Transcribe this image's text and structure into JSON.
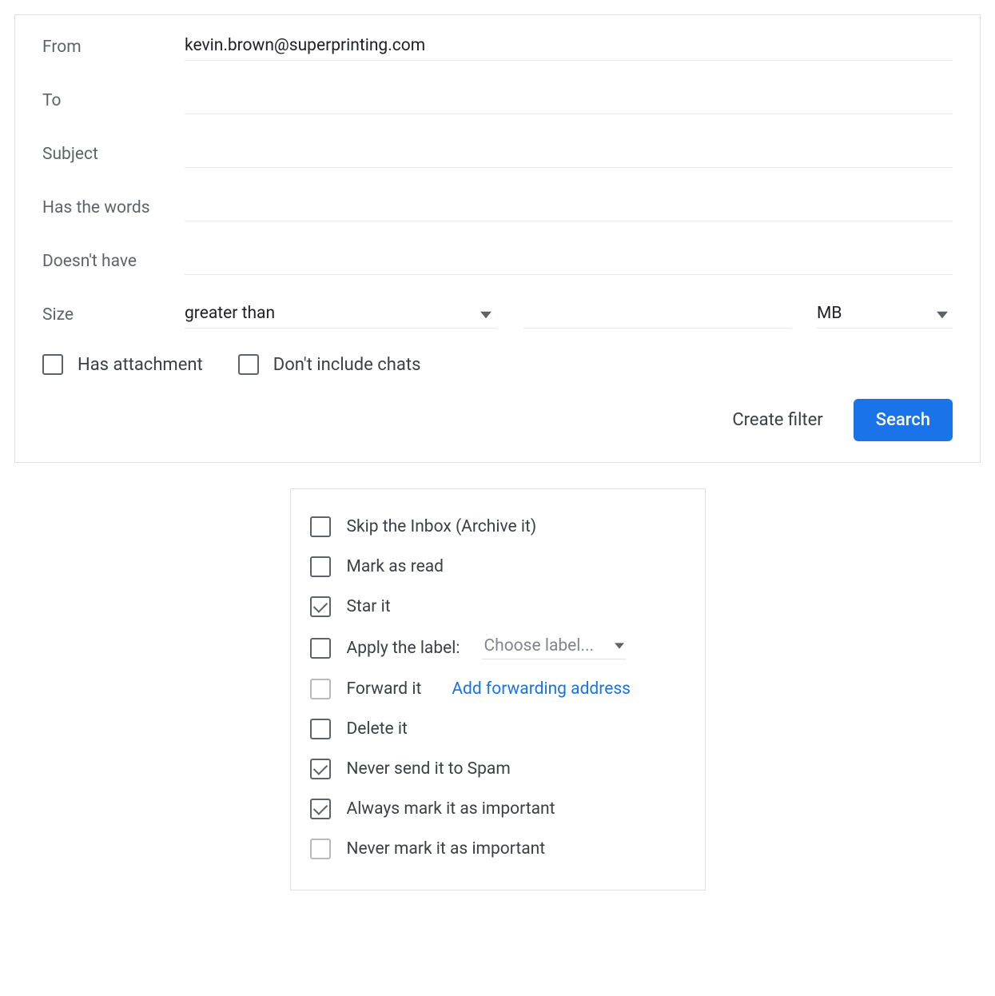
{
  "form": {
    "from": {
      "label": "From",
      "value": "kevin.brown@superprinting.com"
    },
    "to": {
      "label": "To",
      "value": ""
    },
    "subject": {
      "label": "Subject",
      "value": ""
    },
    "has_words": {
      "label": "Has the words",
      "value": ""
    },
    "doesnt_have": {
      "label": "Doesn't have",
      "value": ""
    },
    "size": {
      "label": "Size",
      "operator": "greater than",
      "value": "",
      "unit": "MB"
    },
    "has_attachment": {
      "label": "Has attachment",
      "checked": false
    },
    "no_chats": {
      "label": "Don't include chats",
      "checked": false
    },
    "create_filter": "Create filter",
    "search": "Search"
  },
  "options": {
    "skip_inbox": {
      "label": "Skip the Inbox (Archive it)",
      "checked": false
    },
    "mark_read": {
      "label": "Mark as read",
      "checked": false
    },
    "star_it": {
      "label": "Star it",
      "checked": true
    },
    "apply_label": {
      "label": "Apply the label:",
      "checked": false,
      "select_text": "Choose label..."
    },
    "forward_it": {
      "label": "Forward it",
      "checked": false,
      "link": "Add forwarding address"
    },
    "delete_it": {
      "label": "Delete it",
      "checked": false
    },
    "never_spam": {
      "label": "Never send it to Spam",
      "checked": true
    },
    "always_imp": {
      "label": "Always mark it as important",
      "checked": true
    },
    "never_imp": {
      "label": "Never mark it as important",
      "checked": false
    }
  }
}
